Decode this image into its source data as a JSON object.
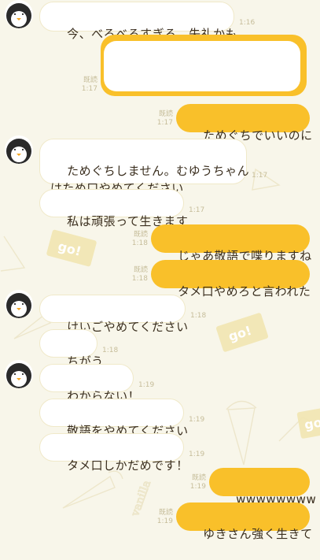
{
  "messages": [
    {
      "id": "m1",
      "side": "in",
      "text": "今、べろべろすぎる、失礼かも",
      "time": "1:16"
    },
    {
      "id": "m2",
      "side": "out",
      "text": "",
      "read": "既読",
      "time": "1:17",
      "redacted": true
    },
    {
      "id": "m3",
      "side": "out",
      "text": "ためぐちでいいのに",
      "read": "既読",
      "time": "1:17"
    },
    {
      "id": "m4",
      "side": "in",
      "text": "ためぐちしません。むゆうちゃん\nはため口やめてください",
      "time": "1:17"
    },
    {
      "id": "m5",
      "side": "in",
      "text": "私は頑張って生きます",
      "time": "1:17"
    },
    {
      "id": "m6",
      "side": "out",
      "text": "じゃあ敬語で喋りますね",
      "read": "既読",
      "time": "1:18"
    },
    {
      "id": "m7",
      "side": "out",
      "text": "タメ口やめろと言われた",
      "read": "既読",
      "time": "1:18"
    },
    {
      "id": "m8",
      "side": "in",
      "text": "けいごやめてください",
      "time": "1:18"
    },
    {
      "id": "m9",
      "side": "in",
      "text": "ちがう",
      "time": "1:18"
    },
    {
      "id": "m10",
      "side": "in",
      "text": "わからない！",
      "time": "1:19"
    },
    {
      "id": "m11",
      "side": "in",
      "text": "敬語をやめてください",
      "time": "1:19"
    },
    {
      "id": "m12",
      "side": "in",
      "text": "タメ口しかだめです！",
      "time": "1:19"
    },
    {
      "id": "m13",
      "side": "out",
      "text": "wwwwwwww",
      "read": "既読",
      "time": "1:19"
    },
    {
      "id": "m14",
      "side": "out",
      "text": "ゆきさん強く生きて",
      "read": "既読",
      "time": "1:19"
    }
  ],
  "background_text": [
    "go!",
    "go!",
    "go!",
    "vanilla"
  ],
  "colors": {
    "background": "#f8f6ea",
    "incoming_bubble": "#ffffff",
    "outgoing_bubble": "#f9c02a",
    "meta_text": "#c6bd9a",
    "message_text": "#3a2e1e"
  },
  "icons": {
    "avatar": "penguin-avatar-icon"
  }
}
